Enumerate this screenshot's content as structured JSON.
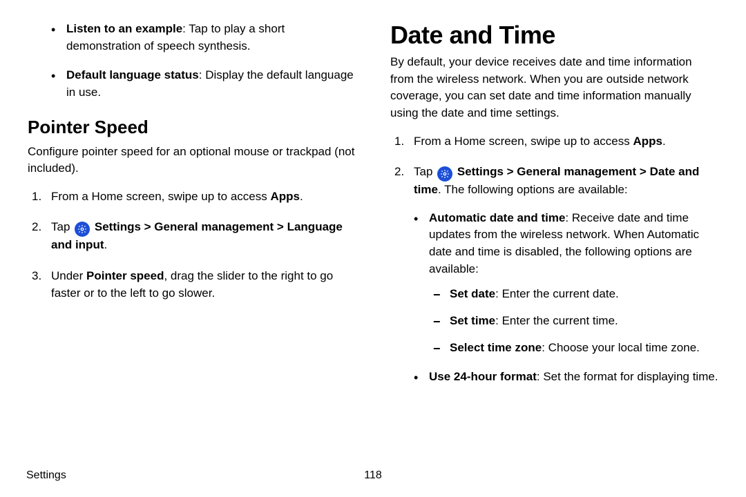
{
  "left": {
    "tts_bullets": [
      {
        "label": "Listen to an example",
        "desc": ": Tap to play a short demonstration of speech synthesis."
      },
      {
        "label": "Default language status",
        "desc": ": Display the default language in use."
      }
    ],
    "pointer_heading": "Pointer Speed",
    "pointer_intro": "Configure pointer speed for an optional mouse or trackpad (not included).",
    "step1_prefix": "From a Home screen, swipe up to access ",
    "step1_bold": "Apps",
    "step1_suffix": ".",
    "step2_tap": "Tap ",
    "step2_path": "Settings > General management > Language and input",
    "step2_suffix": ".",
    "step3_prefix": "Under ",
    "step3_bold": "Pointer speed",
    "step3_suffix": ", drag the slider to the right to go faster or to the left to go slower."
  },
  "right": {
    "heading": "Date and Time",
    "intro": "By default, your device receives date and time information from the wireless network. When you are outside network coverage, you can set date and time information manually using the date and time settings.",
    "step1_prefix": "From a Home screen, swipe up to access ",
    "step1_bold": "Apps",
    "step1_suffix": ".",
    "step2_tap": "Tap ",
    "step2_path": "Settings > General management > Date and time",
    "step2_suffix": ". The following options are available:",
    "auto_label": "Automatic date and time",
    "auto_desc": ": Receive date and time updates from the wireless network. When Automatic date and time is disabled, the following options are available:",
    "set_date_label": "Set date",
    "set_date_desc": ": Enter the current date.",
    "set_time_label": "Set time",
    "set_time_desc": ": Enter the current time.",
    "tz_label": "Select time zone",
    "tz_desc": ": Choose your local time zone.",
    "h24_label": "Use 24-hour format",
    "h24_desc": ": Set the format for displaying time."
  },
  "footer": {
    "section": "Settings",
    "page": "118"
  }
}
